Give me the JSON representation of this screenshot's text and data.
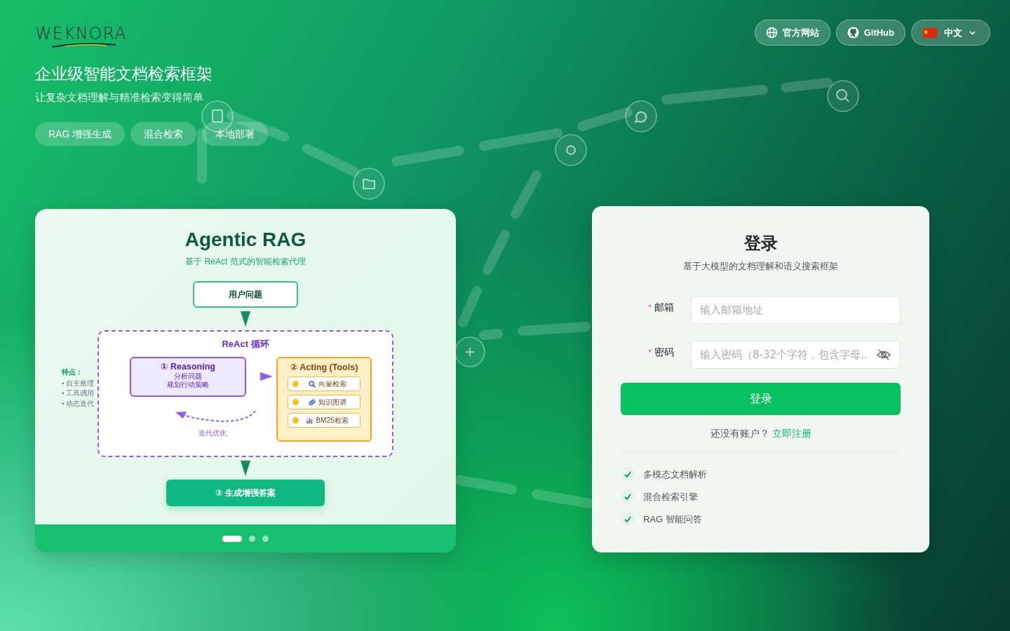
{
  "logo": {
    "text": "WEKNORA"
  },
  "header_buttons": [
    {
      "kind": "globe",
      "label": "官方网站"
    },
    {
      "kind": "github",
      "label": "GitHub"
    },
    {
      "kind": "language",
      "label": "中文"
    }
  ],
  "hero": {
    "title": "企业级智能文档检索框架",
    "subtitle": "让复杂文档理解与精准检索变得简单",
    "tags": [
      "RAG 增强生成",
      "混合检索",
      "本地部署"
    ]
  },
  "carousel": {
    "slide": {
      "title": "Agentic RAG",
      "subtitle": "基于 ReAct 范式的智能检索代理",
      "input": "用户问题",
      "features": {
        "title": "特点：",
        "items": [
          "• 自主推理",
          "• 工具调用",
          "• 动态迭代"
        ]
      },
      "loop": {
        "title": "ReAct 循环",
        "reasoning": {
          "title": "① Reasoning",
          "lines": [
            "分析问题",
            "规划行动策略"
          ]
        },
        "acting": {
          "title": "② Acting (Tools)",
          "tools": [
            {
              "kind": "search",
              "label": "向量检索"
            },
            {
              "kind": "link",
              "label": "知识图谱"
            },
            {
              "kind": "chart",
              "label": "BM25检索"
            }
          ]
        },
        "loop_label": "迭代优化"
      },
      "output": "③ 生成增强答案"
    },
    "dots": [
      {
        "selected": true
      },
      {
        "selected": false
      },
      {
        "selected": false
      }
    ]
  },
  "login": {
    "title": "登录",
    "subtitle": "基于大模型的文档理解和语义搜索框架",
    "fields": [
      {
        "kind": "email",
        "label": "邮箱",
        "required_mark": "*",
        "placeholder": "输入邮箱地址"
      },
      {
        "kind": "password",
        "label": "密码",
        "required_mark": "*",
        "placeholder": "输入密码（8-32个字符，包含字母…"
      }
    ],
    "submit": "登录",
    "signup": {
      "prompt": "还没有账户？",
      "link": "立即注册"
    },
    "features": [
      "多模态文档解析",
      "混合检索引擎",
      "RAG 智能问答"
    ]
  }
}
